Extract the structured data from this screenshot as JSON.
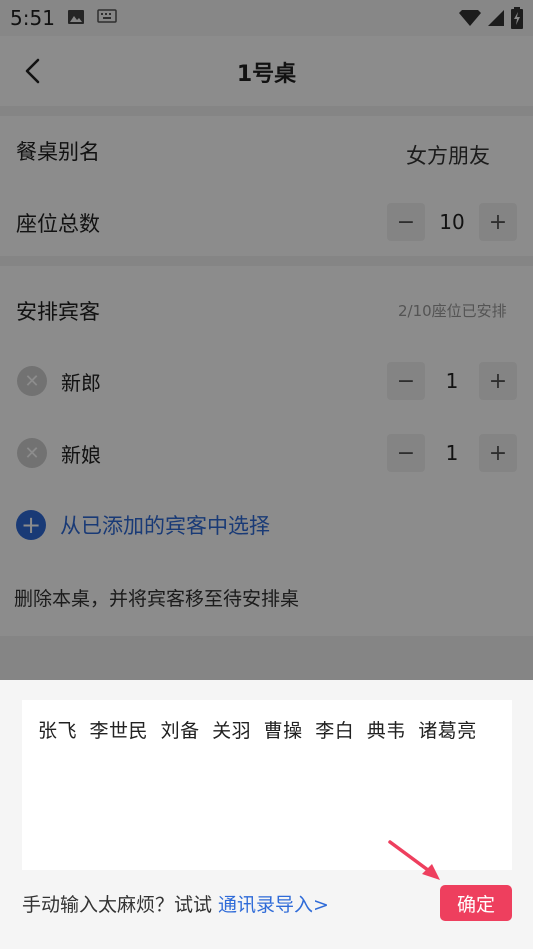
{
  "status_bar": {
    "time": "5:51",
    "left_icons": [
      "image-icon",
      "keyboard-icon"
    ],
    "right_icons": [
      "wifi-icon",
      "signal-icon",
      "battery-icon"
    ]
  },
  "header": {
    "title": "1号桌",
    "back_icon": "back-icon"
  },
  "table_settings": {
    "alias_label": "餐桌别名",
    "alias_value": "女方朋友",
    "seats_label": "座位总数",
    "seats_value": "10",
    "minus": "−",
    "plus": "+"
  },
  "guests": {
    "section_label": "安排宾客",
    "arranged_status": "2/10座位已安排",
    "items": [
      {
        "name": "新郎",
        "count": "1"
      },
      {
        "name": "新娘",
        "count": "1"
      }
    ],
    "add_from_existing": "从已添加的宾客中选择",
    "delete_table": "删除本桌，并将宾客移至待安排桌"
  },
  "sheet": {
    "input_value": "张飞 李世民 刘备 关羽 曹操 李白 典韦 诸葛亮",
    "hint": "手动输入太麻烦？试试",
    "import_link": "通讯录导入>",
    "confirm_label": "确定"
  },
  "colors": {
    "accent_blue": "#2f6bd8",
    "confirm_red": "#ee3f5e",
    "arrow_red": "#ee3f5e"
  }
}
